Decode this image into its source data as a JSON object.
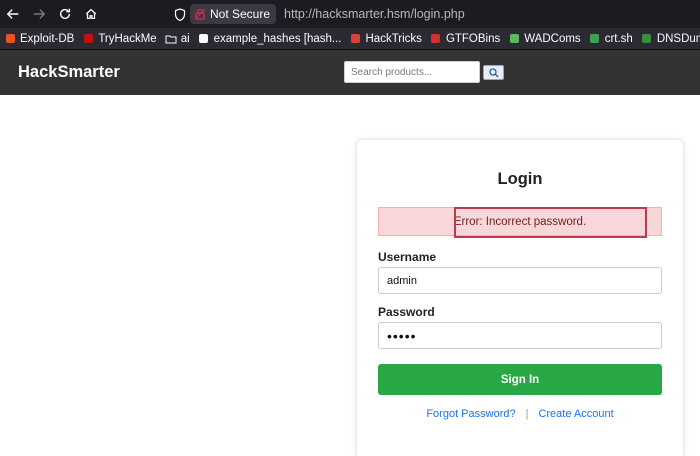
{
  "browser": {
    "security_label": "Not Secure",
    "url": "http://hacksmarter.hsm/login.php"
  },
  "bookmarks": [
    {
      "label": "Exploit-DB",
      "icon": "exploitdb-icon",
      "color": "#e95420"
    },
    {
      "label": "TryHackMe",
      "icon": "tryhackme-icon",
      "color": "#c11111"
    },
    {
      "label": "ai",
      "icon": "folder-icon",
      "color": "#fbfbfe"
    },
    {
      "label": "example_hashes [hash...",
      "icon": "hashcat-icon",
      "color": "#fbfbfe"
    },
    {
      "label": "HackTricks",
      "icon": "hacktricks-icon",
      "color": "#d9413b"
    },
    {
      "label": "GTFOBins",
      "icon": "gtfobins-icon",
      "color": "#d32f2f"
    },
    {
      "label": "WADComs",
      "icon": "wadcoms-icon",
      "color": "#5cb85c"
    },
    {
      "label": "crt.sh",
      "icon": "crtsh-icon",
      "color": "#3fa34d"
    },
    {
      "label": "DNSDumpster",
      "icon": "dnsdumpster-icon",
      "color": "#3b8e3b"
    }
  ],
  "header": {
    "brand": "HackSmarter",
    "search_placeholder": "Search products..."
  },
  "login": {
    "title": "Login",
    "error": "Error: Incorrect password.",
    "username_label": "Username",
    "username_value": "admin",
    "password_label": "Password",
    "password_value": "•••••",
    "submit_label": "Sign In",
    "forgot_label": "Forgot Password?",
    "separator": "|",
    "create_label": "Create Account"
  },
  "colors": {
    "header_bg": "#333333",
    "button_green": "#28a745",
    "error_bg": "#f8d7da",
    "highlight_red": "#c0394b",
    "link_blue": "#1a73e8"
  }
}
